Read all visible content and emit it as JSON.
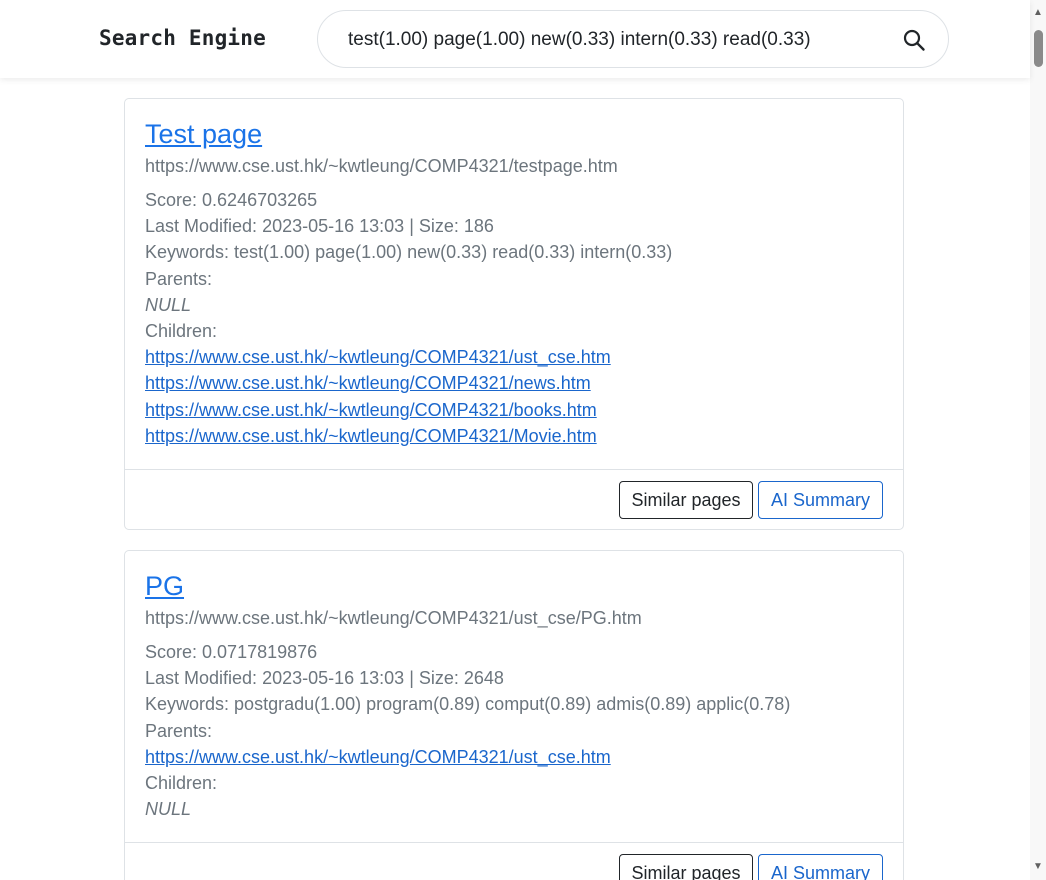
{
  "header": {
    "brand": "Search Engine",
    "search_value": "test(1.00) page(1.00) new(0.33) intern(0.33) read(0.33)",
    "search_icon": "search-icon"
  },
  "labels": {
    "score_prefix": "Score: ",
    "modified_prefix": "Last Modified: ",
    "size_sep": " | Size: ",
    "keywords_prefix": "Keywords: ",
    "parents": "Parents:",
    "children": "Children:",
    "null": "NULL",
    "similar_button": "Similar pages",
    "ai_button": "AI Summary"
  },
  "results": [
    {
      "title": "Test page",
      "url": "https://www.cse.ust.hk/~kwtleung/COMP4321/testpage.htm",
      "score": "0.6246703265",
      "modified": "2023-05-16 13:03",
      "size": "186",
      "keywords": "test(1.00) page(1.00) new(0.33) read(0.33) intern(0.33)",
      "parents": [],
      "children": [
        "https://www.cse.ust.hk/~kwtleung/COMP4321/ust_cse.htm",
        "https://www.cse.ust.hk/~kwtleung/COMP4321/news.htm",
        "https://www.cse.ust.hk/~kwtleung/COMP4321/books.htm",
        "https://www.cse.ust.hk/~kwtleung/COMP4321/Movie.htm"
      ]
    },
    {
      "title": "PG",
      "url": "https://www.cse.ust.hk/~kwtleung/COMP4321/ust_cse/PG.htm",
      "score": "0.0717819876",
      "modified": "2023-05-16 13:03",
      "size": "2648",
      "keywords": "postgradu(1.00) program(0.89) comput(0.89) admis(0.89) applic(0.78)",
      "parents": [
        "https://www.cse.ust.hk/~kwtleung/COMP4321/ust_cse.htm"
      ],
      "children": []
    }
  ]
}
